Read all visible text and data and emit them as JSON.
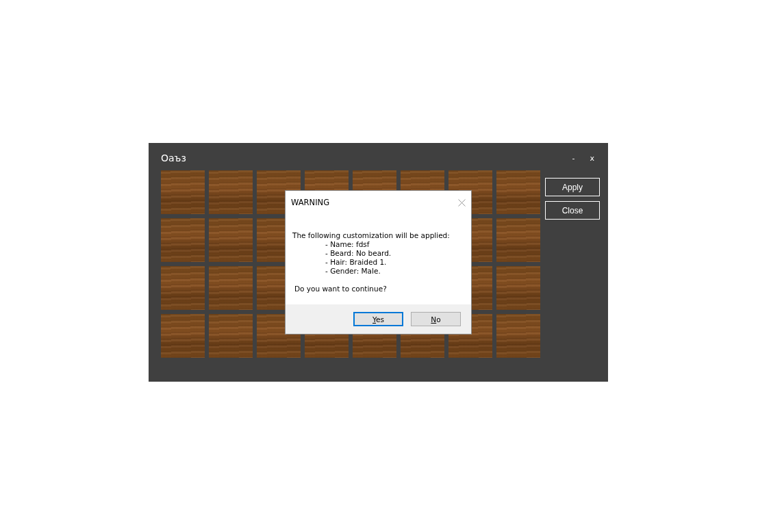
{
  "window": {
    "title": "Оаъз",
    "controls": [
      "-",
      "x"
    ]
  },
  "side_buttons": [
    "Apply",
    "Close"
  ],
  "dialog": {
    "title": "WARNING",
    "intro": "The following customization will be applied:",
    "items": [
      "- Name: fdsf",
      "- Beard: No beard.",
      "- Hair: Braided 1.",
      "- Gender: Male."
    ],
    "question": "Do you want to continue?",
    "buttons": [
      {
        "label": "Yes",
        "default": true
      },
      {
        "label": "No",
        "default": false
      }
    ]
  }
}
